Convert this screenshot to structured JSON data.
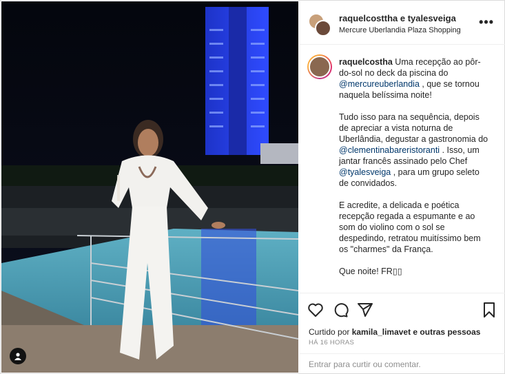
{
  "header": {
    "username": "raquelcosttha e tyalesveiga",
    "location": "Mercure Uberlandia Plaza Shopping",
    "more_label": "•••"
  },
  "caption": {
    "author": "raquelcostha",
    "p1_a": " Uma recepção ao pôr-do-sol no deck da piscina do ",
    "p1_mention": "@mercureuberlandia",
    "p1_b": " , que se tornou naquela belíssima noite!",
    "p2_a": "Tudo isso para na sequência, depois de apreciar a vista noturna de Uberlândia, degustar a gastronomia do ",
    "p2_mention1": "@clementinabareristoranti",
    "p2_b": " . Isso, um jantar francês assinado pelo Chef ",
    "p2_mention2": "@tyalesveiga",
    "p2_c": " , para um grupo seleto de convidados.",
    "p3": "E acredite, a delicada e poética recepção regada a espumante e ao som do violino com o sol se despedindo, retratou muitíssimo bem os \"charmes\" da França.",
    "p4": "Que noite! FR▯▯"
  },
  "likes": {
    "prefix": "Curtido por ",
    "user": "kamila_limavet",
    "suffix": " e outras pessoas"
  },
  "timestamp": "HÁ 16 HORAS",
  "comment_placeholder": "Entrar para curtir ou comentar.",
  "icons": [
    "heart-icon",
    "comment-icon",
    "share-icon",
    "bookmark-icon",
    "user-tag-icon"
  ]
}
